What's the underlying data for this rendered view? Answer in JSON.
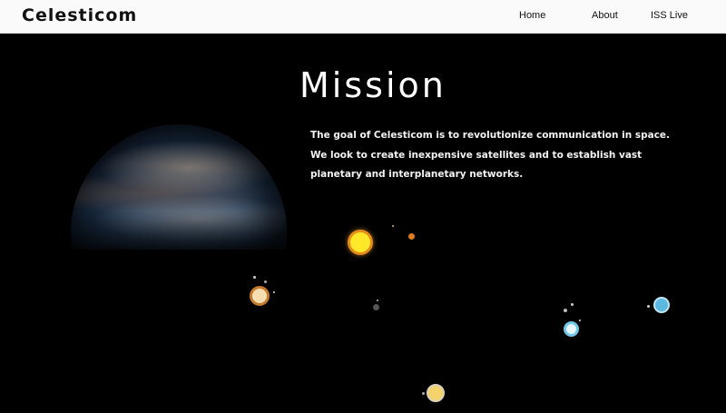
{
  "navbar": {
    "brand": "Celesticom",
    "links": [
      {
        "label": "Home"
      },
      {
        "label": "About"
      },
      {
        "label": "ISS Live"
      }
    ]
  },
  "mission": {
    "title": "Mission",
    "text": "The goal of Celesticom is to revolutionize communication in space. We look to create inexpensive satellites and to establish vast planetary and interplanetary networks."
  },
  "colors": {
    "navbar_bg": "#fafafa",
    "page_bg": "#000000",
    "sun_fill": "#ffe82a",
    "sun_ring": "#e48d1a",
    "blue_planet": "#5bb9e0",
    "cream_planet": "#f5deb0"
  }
}
